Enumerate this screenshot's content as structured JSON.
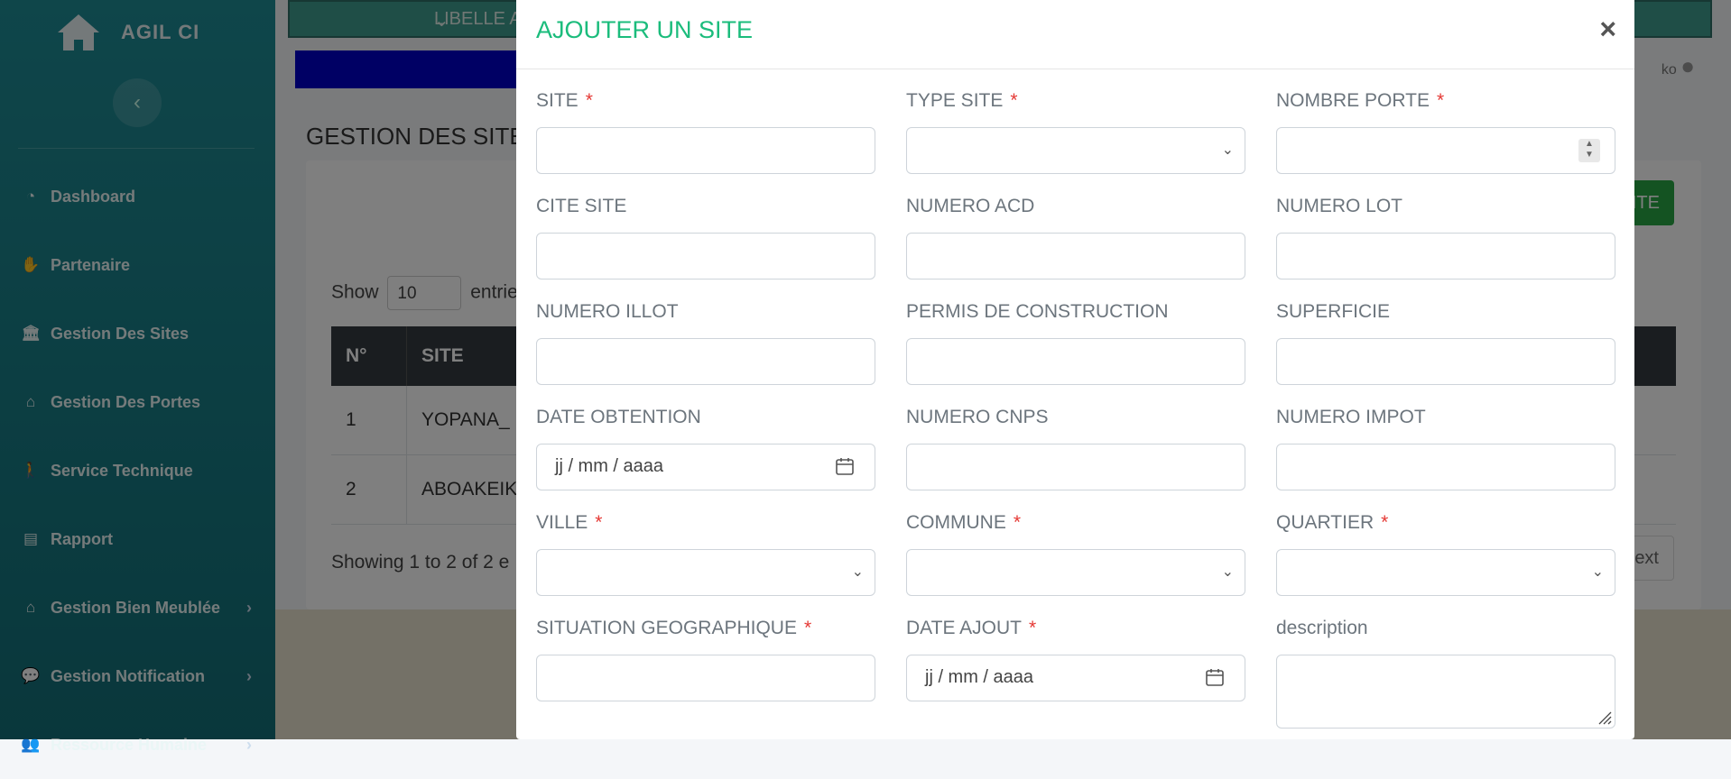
{
  "app": {
    "brand": "AGIL CI",
    "collapse_glyph": "‹"
  },
  "sidebar": {
    "items": [
      {
        "label": "Dashboard",
        "icon": "gauge-icon",
        "glyph": "◔",
        "has_children": false
      },
      {
        "label": "Partenaire",
        "icon": "handshake-icon",
        "glyph": "✋",
        "has_children": false
      },
      {
        "label": "Gestion Des Sites",
        "icon": "bank-icon",
        "glyph": "🏛",
        "has_children": false
      },
      {
        "label": "Gestion Des Portes",
        "icon": "home-icon",
        "glyph": "⌂",
        "has_children": false
      },
      {
        "label": "Service Technique",
        "icon": "walking-icon",
        "glyph": "🚶",
        "has_children": false
      },
      {
        "label": "Rapport",
        "icon": "file-icon",
        "glyph": "▤",
        "has_children": false
      },
      {
        "label": "Gestion Bien Meublée",
        "icon": "home-icon",
        "glyph": "⌂",
        "has_children": true
      },
      {
        "label": "Gestion Notification",
        "icon": "comment-icon",
        "glyph": "💬",
        "has_children": true
      },
      {
        "label": "Ressource Humaine",
        "icon": "users-icon",
        "glyph": "👥",
        "has_children": true
      }
    ],
    "chevron_glyph": "›"
  },
  "background": {
    "top_select": "LIBELLE A",
    "user_name": "ko",
    "page_title": "GESTION DES SITE",
    "add_button": "ITE",
    "show_label": "Show",
    "show_value": "10",
    "entries_label": "entrie",
    "table_headers": [
      "N°",
      "SITE"
    ],
    "rows": [
      {
        "n": "1",
        "site": "YOPANA_"
      },
      {
        "n": "2",
        "site": "ABOAKEIK"
      }
    ],
    "showing": "Showing 1 to 2 of 2 e",
    "next": "ext"
  },
  "modal": {
    "title": "AJOUTER UN SITE",
    "close": "×",
    "fields": [
      {
        "label": "SITE",
        "required": true,
        "type": "text",
        "value": ""
      },
      {
        "label": "TYPE SITE",
        "required": true,
        "type": "select",
        "value": ""
      },
      {
        "label": "NOMBRE PORTE",
        "required": true,
        "type": "number",
        "value": ""
      },
      {
        "label": "CITE SITE",
        "required": false,
        "type": "text",
        "value": ""
      },
      {
        "label": "NUMERO ACD",
        "required": false,
        "type": "text",
        "value": ""
      },
      {
        "label": "NUMERO LOT",
        "required": false,
        "type": "text",
        "value": ""
      },
      {
        "label": "NUMERO ILLOT",
        "required": false,
        "type": "text",
        "value": ""
      },
      {
        "label": "PERMIS DE CONSTRUCTION",
        "required": false,
        "type": "text",
        "value": ""
      },
      {
        "label": "SUPERFICIE",
        "required": false,
        "type": "text",
        "value": ""
      },
      {
        "label": "DATE OBTENTION",
        "required": false,
        "type": "date",
        "value": "jj / mm / aaaa"
      },
      {
        "label": "NUMERO CNPS",
        "required": false,
        "type": "text",
        "value": ""
      },
      {
        "label": "NUMERO IMPOT",
        "required": false,
        "type": "text",
        "value": ""
      },
      {
        "label": "VILLE",
        "required": true,
        "type": "select",
        "value": ""
      },
      {
        "label": "COMMUNE",
        "required": true,
        "type": "select",
        "value": ""
      },
      {
        "label": "QUARTIER",
        "required": true,
        "type": "select",
        "value": ""
      },
      {
        "label": "SITUATION GEOGRAPHIQUE",
        "required": true,
        "type": "text",
        "value": ""
      },
      {
        "label": "DATE AJOUT",
        "required": true,
        "type": "date",
        "value": "jj / mm / aaaa"
      },
      {
        "label": "description",
        "required": false,
        "type": "textarea",
        "value": ""
      }
    ],
    "required_mark": "*"
  },
  "colors": {
    "accent": "#1bbc7c",
    "sidebar": "#1a7f88",
    "required": "#e53935"
  }
}
